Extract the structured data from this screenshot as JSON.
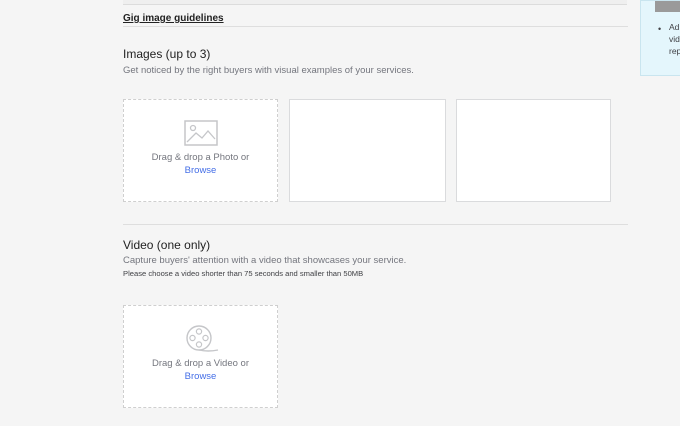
{
  "guidelines_link": "Gig image guidelines",
  "images": {
    "title": "Images (up to 3)",
    "subtitle": "Get noticed by the right buyers with visual examples of your services.",
    "drop_text": "Drag & drop a Photo or",
    "browse": "Browse"
  },
  "video": {
    "title": "Video (one only)",
    "subtitle": "Capture buyers' attention with a video that showcases your service.",
    "note": "Please choose a video shorter than 75 seconds and smaller than 50MB",
    "drop_text": "Drag & drop a Video or",
    "browse": "Browse"
  },
  "tip": {
    "bullet": "•",
    "lines": [
      "Ad",
      "vid",
      "rep"
    ]
  },
  "colors": {
    "background": "#f5f5f5",
    "link": "#446ee7",
    "tip_background": "#e4f6fc"
  },
  "icons": {
    "photo": "image-placeholder-icon",
    "video": "film-reel-icon"
  }
}
